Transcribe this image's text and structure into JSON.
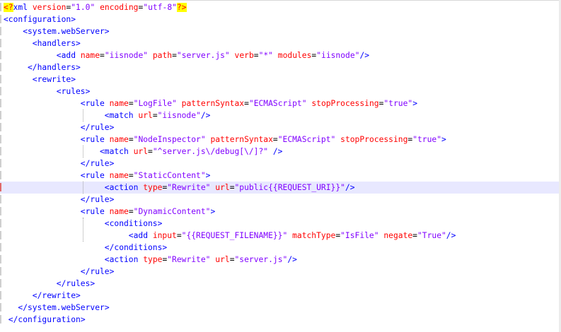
{
  "editor": {
    "current_line": 15,
    "changed_lines": [
      15
    ],
    "lines": [
      {
        "indent": 0,
        "tokens": [
          {
            "t": "<?",
            "k": "pi"
          },
          {
            "t": "xml ",
            "k": "punct"
          },
          {
            "t": "version",
            "k": "attr"
          },
          {
            "t": "=",
            "k": "text"
          },
          {
            "t": "\"1.0\"",
            "k": "val"
          },
          {
            "t": " ",
            "k": "text"
          },
          {
            "t": "encoding",
            "k": "attr"
          },
          {
            "t": "=",
            "k": "text"
          },
          {
            "t": "\"utf-8\"",
            "k": "val"
          },
          {
            "t": "?>",
            "k": "pi"
          }
        ]
      },
      {
        "indent": 0,
        "tokens": [
          {
            "t": "<configuration>",
            "k": "punct"
          }
        ]
      },
      {
        "indent": 4,
        "tokens": [
          {
            "t": "<system.webServer>",
            "k": "punct"
          }
        ]
      },
      {
        "indent": 6,
        "tokens": [
          {
            "t": "<handlers>",
            "k": "punct"
          }
        ]
      },
      {
        "indent": 11,
        "tokens": [
          {
            "t": "<add ",
            "k": "punct"
          },
          {
            "t": "name",
            "k": "attr"
          },
          {
            "t": "=",
            "k": "text"
          },
          {
            "t": "\"iisnode\"",
            "k": "val"
          },
          {
            "t": " ",
            "k": "text"
          },
          {
            "t": "path",
            "k": "attr"
          },
          {
            "t": "=",
            "k": "text"
          },
          {
            "t": "\"server.js\"",
            "k": "val"
          },
          {
            "t": " ",
            "k": "text"
          },
          {
            "t": "verb",
            "k": "attr"
          },
          {
            "t": "=",
            "k": "text"
          },
          {
            "t": "\"*\"",
            "k": "val"
          },
          {
            "t": " ",
            "k": "text"
          },
          {
            "t": "modules",
            "k": "attr"
          },
          {
            "t": "=",
            "k": "text"
          },
          {
            "t": "\"iisnode\"",
            "k": "val"
          },
          {
            "t": "/>",
            "k": "punct"
          }
        ]
      },
      {
        "indent": 5,
        "tokens": [
          {
            "t": "</handlers>",
            "k": "punct"
          }
        ]
      },
      {
        "indent": 6,
        "tokens": [
          {
            "t": "<rewrite>",
            "k": "punct"
          }
        ]
      },
      {
        "indent": 11,
        "tokens": [
          {
            "t": "<rules>",
            "k": "punct"
          }
        ]
      },
      {
        "indent": 16,
        "tokens": [
          {
            "t": "<rule ",
            "k": "punct"
          },
          {
            "t": "name",
            "k": "attr"
          },
          {
            "t": "=",
            "k": "text"
          },
          {
            "t": "\"LogFile\"",
            "k": "val"
          },
          {
            "t": " ",
            "k": "text"
          },
          {
            "t": "patternSyntax",
            "k": "attr"
          },
          {
            "t": "=",
            "k": "text"
          },
          {
            "t": "\"ECMAScript\"",
            "k": "val"
          },
          {
            "t": " ",
            "k": "text"
          },
          {
            "t": "stopProcessing",
            "k": "attr"
          },
          {
            "t": "=",
            "k": "text"
          },
          {
            "t": "\"true\"",
            "k": "val"
          },
          {
            "t": ">",
            "k": "punct"
          }
        ]
      },
      {
        "indent": 21,
        "tokens": [
          {
            "t": "<match ",
            "k": "punct"
          },
          {
            "t": "url",
            "k": "attr"
          },
          {
            "t": "=",
            "k": "text"
          },
          {
            "t": "\"iisnode\"",
            "k": "val"
          },
          {
            "t": "/>",
            "k": "punct"
          }
        ]
      },
      {
        "indent": 16,
        "tokens": [
          {
            "t": "</rule>",
            "k": "punct"
          }
        ]
      },
      {
        "indent": 16,
        "tokens": [
          {
            "t": "<rule ",
            "k": "punct"
          },
          {
            "t": "name",
            "k": "attr"
          },
          {
            "t": "=",
            "k": "text"
          },
          {
            "t": "\"NodeInspector\"",
            "k": "val"
          },
          {
            "t": " ",
            "k": "text"
          },
          {
            "t": "patternSyntax",
            "k": "attr"
          },
          {
            "t": "=",
            "k": "text"
          },
          {
            "t": "\"ECMAScript\"",
            "k": "val"
          },
          {
            "t": " ",
            "k": "text"
          },
          {
            "t": "stopProcessing",
            "k": "attr"
          },
          {
            "t": "=",
            "k": "text"
          },
          {
            "t": "\"true\"",
            "k": "val"
          },
          {
            "t": ">",
            "k": "punct"
          }
        ]
      },
      {
        "indent": 20,
        "tokens": [
          {
            "t": "<match ",
            "k": "punct"
          },
          {
            "t": "url",
            "k": "attr"
          },
          {
            "t": "=",
            "k": "text"
          },
          {
            "t": "\"^server.js\\/debug[\\/]?\"",
            "k": "val"
          },
          {
            "t": " />",
            "k": "punct"
          }
        ]
      },
      {
        "indent": 16,
        "tokens": [
          {
            "t": "</rule>",
            "k": "punct"
          }
        ]
      },
      {
        "indent": 16,
        "tokens": [
          {
            "t": "<rule ",
            "k": "punct"
          },
          {
            "t": "name",
            "k": "attr"
          },
          {
            "t": "=",
            "k": "text"
          },
          {
            "t": "\"StaticContent\"",
            "k": "val"
          },
          {
            "t": ">",
            "k": "punct"
          }
        ]
      },
      {
        "indent": 21,
        "tokens": [
          {
            "t": "<action ",
            "k": "punct"
          },
          {
            "t": "type",
            "k": "attr"
          },
          {
            "t": "=",
            "k": "text"
          },
          {
            "t": "\"Rewrite\"",
            "k": "val"
          },
          {
            "t": " ",
            "k": "text"
          },
          {
            "t": "url",
            "k": "attr"
          },
          {
            "t": "=",
            "k": "text"
          },
          {
            "t": "\"public{{REQUEST_URI}}\"",
            "k": "val"
          },
          {
            "t": "/>",
            "k": "punct"
          }
        ]
      },
      {
        "indent": 16,
        "tokens": [
          {
            "t": "</rule>",
            "k": "punct"
          }
        ]
      },
      {
        "indent": 16,
        "tokens": [
          {
            "t": "<rule ",
            "k": "punct"
          },
          {
            "t": "name",
            "k": "attr"
          },
          {
            "t": "=",
            "k": "text"
          },
          {
            "t": "\"DynamicContent\"",
            "k": "val"
          },
          {
            "t": ">",
            "k": "punct"
          }
        ]
      },
      {
        "indent": 21,
        "tokens": [
          {
            "t": "<conditions>",
            "k": "punct"
          }
        ]
      },
      {
        "indent": 26,
        "tokens": [
          {
            "t": "<add ",
            "k": "punct"
          },
          {
            "t": "input",
            "k": "attr"
          },
          {
            "t": "=",
            "k": "text"
          },
          {
            "t": "\"{{REQUEST_FILENAME}}\"",
            "k": "val"
          },
          {
            "t": " ",
            "k": "text"
          },
          {
            "t": "matchType",
            "k": "attr"
          },
          {
            "t": "=",
            "k": "text"
          },
          {
            "t": "\"IsFile\"",
            "k": "val"
          },
          {
            "t": " ",
            "k": "text"
          },
          {
            "t": "negate",
            "k": "attr"
          },
          {
            "t": "=",
            "k": "text"
          },
          {
            "t": "\"True\"",
            "k": "val"
          },
          {
            "t": "/>",
            "k": "punct"
          }
        ]
      },
      {
        "indent": 21,
        "tokens": [
          {
            "t": "</conditions>",
            "k": "punct"
          }
        ]
      },
      {
        "indent": 21,
        "tokens": [
          {
            "t": "<action ",
            "k": "punct"
          },
          {
            "t": "type",
            "k": "attr"
          },
          {
            "t": "=",
            "k": "text"
          },
          {
            "t": "\"Rewrite\"",
            "k": "val"
          },
          {
            "t": " ",
            "k": "text"
          },
          {
            "t": "url",
            "k": "attr"
          },
          {
            "t": "=",
            "k": "text"
          },
          {
            "t": "\"server.js\"",
            "k": "val"
          },
          {
            "t": "/>",
            "k": "punct"
          }
        ]
      },
      {
        "indent": 16,
        "tokens": [
          {
            "t": "</rule>",
            "k": "punct"
          }
        ]
      },
      {
        "indent": 11,
        "tokens": [
          {
            "t": "</rules>",
            "k": "punct"
          }
        ]
      },
      {
        "indent": 6,
        "tokens": [
          {
            "t": "</rewrite>",
            "k": "punct"
          }
        ]
      },
      {
        "indent": 3,
        "tokens": [
          {
            "t": "</system.webServer>",
            "k": "punct"
          }
        ]
      },
      {
        "indent": 1,
        "tokens": [
          {
            "t": "</configuration>",
            "k": "punct"
          }
        ]
      }
    ]
  }
}
